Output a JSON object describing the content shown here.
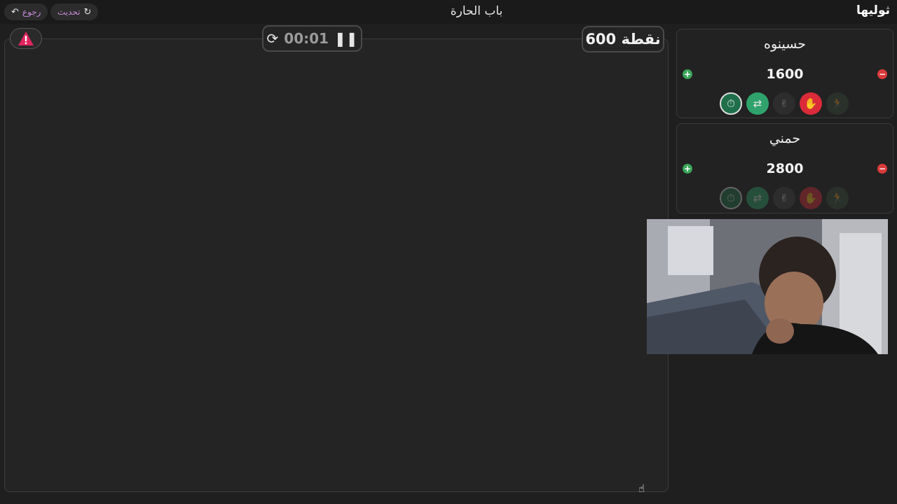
{
  "topbar": {
    "back_label": "رجوع",
    "refresh_label": "تحديث",
    "title": "باب الحارة",
    "logo_text": "ثوليها"
  },
  "game": {
    "timer": "00:01",
    "points": "600 نقطة"
  },
  "teams": [
    {
      "name": "حسينوه",
      "score": "1600",
      "helpers_active": true
    },
    {
      "name": "حمني",
      "score": "2800",
      "helpers_active": false
    }
  ],
  "helper_icons": [
    "stopwatch-icon",
    "swap-icon",
    "two-fingers-icon",
    "stop-hand-icon",
    "runner-icon"
  ],
  "colors": {
    "accent_purple": "#c48bd8",
    "plus_green": "#3aa55a",
    "minus_red": "#d93a3a",
    "alert_red": "#e0245e"
  }
}
